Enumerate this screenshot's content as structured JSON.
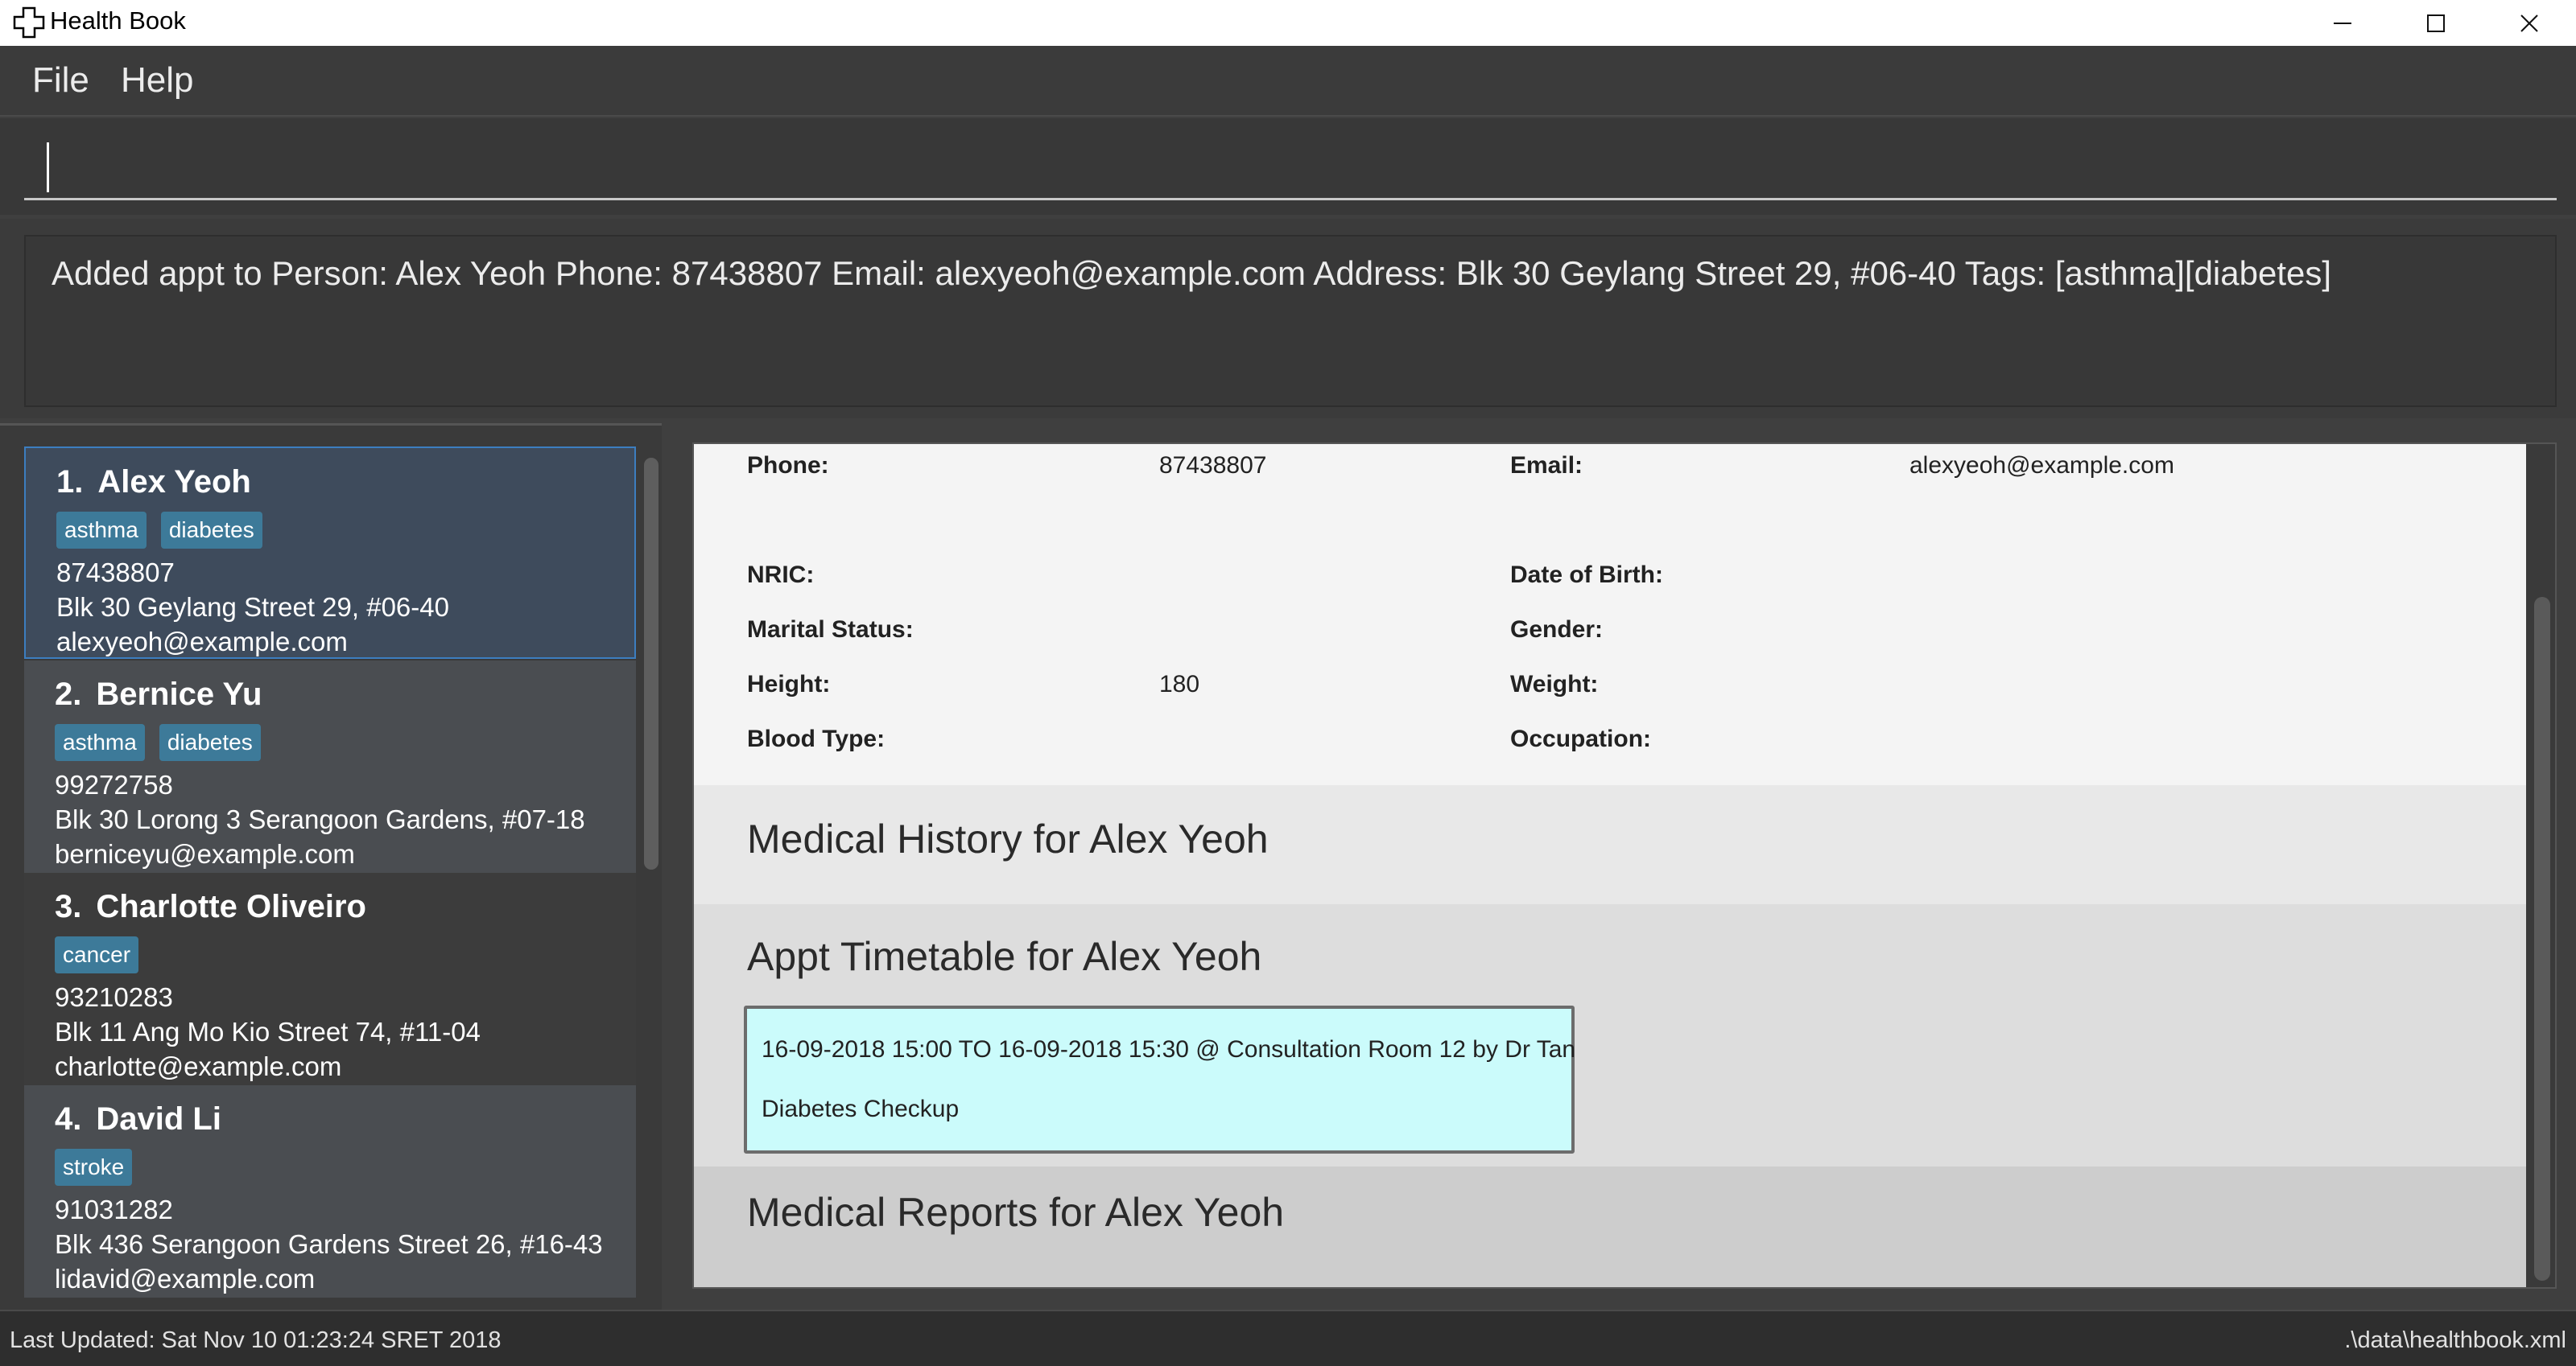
{
  "window": {
    "title": "Health Book",
    "icon": "cross-icon",
    "controls": {
      "minimize": "minimize-icon",
      "maximize": "maximize-icon",
      "close": "close-icon"
    }
  },
  "menu": {
    "file": "File",
    "help": "Help"
  },
  "command": {
    "value": "",
    "placeholder": ""
  },
  "result": {
    "text": "Added appt to Person: Alex Yeoh Phone: 87438807 Email: alexyeoh@example.com Address: Blk 30 Geylang Street 29, #06-40 Tags: [asthma][diabetes]"
  },
  "persons": [
    {
      "index": "1.",
      "name": "Alex Yeoh",
      "tags": [
        "asthma",
        "diabetes"
      ],
      "phone": "87438807",
      "address": "Blk 30 Geylang Street 29, #06-40",
      "email": "alexyeoh@example.com"
    },
    {
      "index": "2.",
      "name": "Bernice Yu",
      "tags": [
        "asthma",
        "diabetes"
      ],
      "phone": "99272758",
      "address": "Blk 30 Lorong 3 Serangoon Gardens, #07-18",
      "email": "berniceyu@example.com"
    },
    {
      "index": "3.",
      "name": "Charlotte Oliveiro",
      "tags": [
        "cancer"
      ],
      "phone": "93210283",
      "address": "Blk 11 Ang Mo Kio Street 74, #11-04",
      "email": "charlotte@example.com"
    },
    {
      "index": "4.",
      "name": "David Li",
      "tags": [
        "stroke"
      ],
      "phone": "91031282",
      "address": "Blk 436 Serangoon Gardens Street 26, #16-43",
      "email": "lidavid@example.com"
    }
  ],
  "detail": {
    "phone_label": "Phone:",
    "phone_value": "87438807",
    "email_label": "Email:",
    "email_value": "alexyeoh@example.com",
    "nric_label": "NRIC:",
    "dob_label": "Date of Birth:",
    "marital_label": "Marital Status:",
    "gender_label": "Gender:",
    "height_label": "Height:",
    "height_value": "180",
    "weight_label": "Weight:",
    "blood_label": "Blood Type:",
    "occupation_label": "Occupation:",
    "history_title": "Medical History for Alex Yeoh",
    "appt_title": "Appt Timetable for Alex Yeoh",
    "appt_line1": "16-09-2018 15:00 TO 16-09-2018 15:30 @ Consultation Room 12 by Dr Tan",
    "appt_line2": "Diabetes Checkup",
    "reports_title": "Medical Reports for Alex Yeoh"
  },
  "status": {
    "last_updated": "Last Updated: Sat Nov 10 01:23:24 SRET 2018",
    "file_path": ".\\data\\healthbook.xml"
  }
}
